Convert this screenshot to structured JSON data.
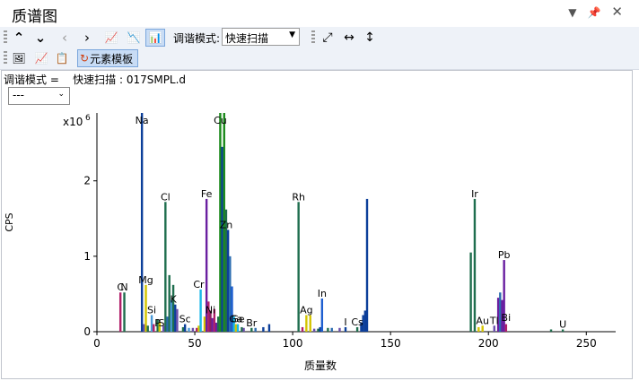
{
  "window": {
    "title": "质谱图"
  },
  "toolbar": {
    "mode_label": "调谐模式:",
    "mode_value": "快速扫描",
    "template_button": "元素模板"
  },
  "info": {
    "mode_text": "调谐模式 =",
    "scan_text": "快速扫描 : 017SMPL.d",
    "combo_value": "---"
  },
  "chart_data": {
    "type": "bar",
    "xlabel": "质量数",
    "ylabel": "CPS",
    "yscale_label": "x10",
    "yscale_exp": "6",
    "xlim": [
      0,
      265
    ],
    "ylim": [
      0,
      2.9
    ],
    "xticks": [
      0,
      50,
      100,
      150,
      200,
      250
    ],
    "yticks": [
      0,
      1,
      2
    ],
    "bars": [
      {
        "x": 12,
        "y": 0.52,
        "c": "#b0206a"
      },
      {
        "x": 14,
        "y": 0.52,
        "c": "#1f6e4e"
      },
      {
        "x": 24,
        "y": 0.1,
        "c": "#6a4faa"
      },
      {
        "x": 25,
        "y": 0.62,
        "c": "#d4c400"
      },
      {
        "x": 26,
        "y": 0.08,
        "c": "#1f6e4e"
      },
      {
        "x": 23,
        "y": 2.9,
        "c": "#0c3f9a"
      },
      {
        "x": 28,
        "y": 0.22,
        "c": "#4a9ad8"
      },
      {
        "x": 29,
        "y": 0.1,
        "c": "#b0206a"
      },
      {
        "x": 31,
        "y": 0.16,
        "c": "#1f6e4e"
      },
      {
        "x": 32,
        "y": 0.12,
        "c": "#d4c400"
      },
      {
        "x": 34,
        "y": 0.08,
        "c": "#6a4faa"
      },
      {
        "x": 35,
        "y": 1.72,
        "c": "#1f6e4e"
      },
      {
        "x": 36,
        "y": 0.2,
        "c": "#2b6cb0"
      },
      {
        "x": 37,
        "y": 0.75,
        "c": "#1f6e4e"
      },
      {
        "x": 38,
        "y": 0.42,
        "c": "#4a9ad8"
      },
      {
        "x": 39,
        "y": 0.62,
        "c": "#1f6e4e"
      },
      {
        "x": 40,
        "y": 0.36,
        "c": "#0c3f9a"
      },
      {
        "x": 41,
        "y": 0.3,
        "c": "#6a4faa"
      },
      {
        "x": 44,
        "y": 0.06,
        "c": "#1f6e4e"
      },
      {
        "x": 45,
        "y": 0.1,
        "c": "#0c3f9a"
      },
      {
        "x": 47,
        "y": 0.05,
        "c": "#4a9ad8"
      },
      {
        "x": 49,
        "y": 0.05,
        "c": "#6a4faa"
      },
      {
        "x": 51,
        "y": 0.05,
        "c": "#b0206a"
      },
      {
        "x": 52,
        "y": 0.08,
        "c": "#d4c400"
      },
      {
        "x": 53,
        "y": 0.56,
        "c": "#18b8e8"
      },
      {
        "x": 55,
        "y": 0.2,
        "c": "#d4c400"
      },
      {
        "x": 56,
        "y": 1.76,
        "c": "#6a1fa0"
      },
      {
        "x": 57,
        "y": 0.4,
        "c": "#b0206a"
      },
      {
        "x": 58,
        "y": 0.28,
        "c": "#8a2060"
      },
      {
        "x": 59,
        "y": 0.18,
        "c": "#6a1fa0"
      },
      {
        "x": 60,
        "y": 0.3,
        "c": "#b0206a"
      },
      {
        "x": 61,
        "y": 0.12,
        "c": "#6a1fa0"
      },
      {
        "x": 62,
        "y": 0.2,
        "c": "#1f6e4e"
      },
      {
        "x": 63,
        "y": 2.9,
        "c": "#1a8a1a"
      },
      {
        "x": 64,
        "y": 2.45,
        "c": "#0c3f9a"
      },
      {
        "x": 65,
        "y": 2.9,
        "c": "#1a8a1a"
      },
      {
        "x": 66,
        "y": 1.62,
        "c": "#1f6e4e"
      },
      {
        "x": 67,
        "y": 1.35,
        "c": "#0c3f9a"
      },
      {
        "x": 68,
        "y": 1.0,
        "c": "#2b6cb0"
      },
      {
        "x": 69,
        "y": 0.6,
        "c": "#1e5fd0"
      },
      {
        "x": 70,
        "y": 0.2,
        "c": "#18b8e8"
      },
      {
        "x": 71,
        "y": 0.1,
        "c": "#d4c400"
      },
      {
        "x": 72,
        "y": 0.1,
        "c": "#18b8e8"
      },
      {
        "x": 74,
        "y": 0.06,
        "c": "#1f6e4e"
      },
      {
        "x": 75,
        "y": 0.05,
        "c": "#6a4faa"
      },
      {
        "x": 79,
        "y": 0.05,
        "c": "#1f6e4e"
      },
      {
        "x": 81,
        "y": 0.05,
        "c": "#2b6cb0"
      },
      {
        "x": 85,
        "y": 0.06,
        "c": "#0c3f9a"
      },
      {
        "x": 88,
        "y": 0.1,
        "c": "#0c3f9a"
      },
      {
        "x": 103,
        "y": 1.72,
        "c": "#1f6e4e"
      },
      {
        "x": 105,
        "y": 0.06,
        "c": "#b0206a"
      },
      {
        "x": 107,
        "y": 0.22,
        "c": "#d4c400"
      },
      {
        "x": 109,
        "y": 0.22,
        "c": "#d4c400"
      },
      {
        "x": 111,
        "y": 0.04,
        "c": "#6a4faa"
      },
      {
        "x": 113,
        "y": 0.04,
        "c": "#1f6e4e"
      },
      {
        "x": 114,
        "y": 0.06,
        "c": "#0c3f9a"
      },
      {
        "x": 115,
        "y": 0.44,
        "c": "#1e5fd0"
      },
      {
        "x": 118,
        "y": 0.05,
        "c": "#1f6e4e"
      },
      {
        "x": 120,
        "y": 0.05,
        "c": "#2b6cb0"
      },
      {
        "x": 124,
        "y": 0.05,
        "c": "#6a4faa"
      },
      {
        "x": 127,
        "y": 0.06,
        "c": "#0c3f9a"
      },
      {
        "x": 133,
        "y": 0.06,
        "c": "#1f6e4e"
      },
      {
        "x": 135,
        "y": 0.12,
        "c": "#0c3f9a"
      },
      {
        "x": 136,
        "y": 0.22,
        "c": "#0c3f9a"
      },
      {
        "x": 137,
        "y": 0.28,
        "c": "#0c3f9a"
      },
      {
        "x": 138,
        "y": 1.76,
        "c": "#0c3f9a"
      },
      {
        "x": 191,
        "y": 1.05,
        "c": "#1f6e4e"
      },
      {
        "x": 193,
        "y": 1.76,
        "c": "#1f6e4e"
      },
      {
        "x": 195,
        "y": 0.06,
        "c": "#d4c400"
      },
      {
        "x": 197,
        "y": 0.08,
        "c": "#d4c400"
      },
      {
        "x": 203,
        "y": 0.08,
        "c": "#6a4faa"
      },
      {
        "x": 205,
        "y": 0.45,
        "c": "#6a1fa0"
      },
      {
        "x": 206,
        "y": 0.52,
        "c": "#2b6cb0"
      },
      {
        "x": 207,
        "y": 0.42,
        "c": "#6a1fa0"
      },
      {
        "x": 208,
        "y": 0.95,
        "c": "#6a1fa0"
      },
      {
        "x": 209,
        "y": 0.1,
        "c": "#b0206a"
      },
      {
        "x": 232,
        "y": 0.03,
        "c": "#1f6e4e"
      },
      {
        "x": 238,
        "y": 0.03,
        "c": "#1f6e4e"
      }
    ],
    "labels": [
      {
        "x": 12,
        "y": 0.52,
        "text": "C"
      },
      {
        "x": 14,
        "y": 0.52,
        "text": "N"
      },
      {
        "x": 23,
        "y": 2.9,
        "text": "Na"
      },
      {
        "x": 25,
        "y": 0.62,
        "text": "Mg"
      },
      {
        "x": 28,
        "y": 0.22,
        "text": "Si"
      },
      {
        "x": 31,
        "y": 0.05,
        "text": "P"
      },
      {
        "x": 33,
        "y": 0.05,
        "text": "S"
      },
      {
        "x": 35,
        "y": 1.72,
        "text": "Cl"
      },
      {
        "x": 39,
        "y": 0.36,
        "text": "K"
      },
      {
        "x": 45,
        "y": 0.1,
        "text": "Sc"
      },
      {
        "x": 52,
        "y": 0.56,
        "text": "Cr"
      },
      {
        "x": 56,
        "y": 1.76,
        "text": "Fe"
      },
      {
        "x": 58,
        "y": 0.22,
        "text": "Ni"
      },
      {
        "x": 63,
        "y": 2.9,
        "text": "Cu"
      },
      {
        "x": 66,
        "y": 1.35,
        "text": "Zn"
      },
      {
        "x": 71,
        "y": 0.1,
        "text": "Ga"
      },
      {
        "x": 72,
        "y": 0.1,
        "text": "Ge"
      },
      {
        "x": 79,
        "y": 0.05,
        "text": "Br"
      },
      {
        "x": 103,
        "y": 1.72,
        "text": "Rh"
      },
      {
        "x": 107,
        "y": 0.22,
        "text": "Ag"
      },
      {
        "x": 115,
        "y": 0.44,
        "text": "In"
      },
      {
        "x": 127,
        "y": 0.06,
        "text": "I"
      },
      {
        "x": 133,
        "y": 0.06,
        "text": "Cs"
      },
      {
        "x": 193,
        "y": 1.76,
        "text": "Ir"
      },
      {
        "x": 197,
        "y": 0.08,
        "text": "Au"
      },
      {
        "x": 203,
        "y": 0.08,
        "text": "Tl"
      },
      {
        "x": 208,
        "y": 0.95,
        "text": "Pb"
      },
      {
        "x": 209,
        "y": 0.12,
        "text": "Bi"
      },
      {
        "x": 238,
        "y": 0.03,
        "text": "U"
      }
    ]
  }
}
